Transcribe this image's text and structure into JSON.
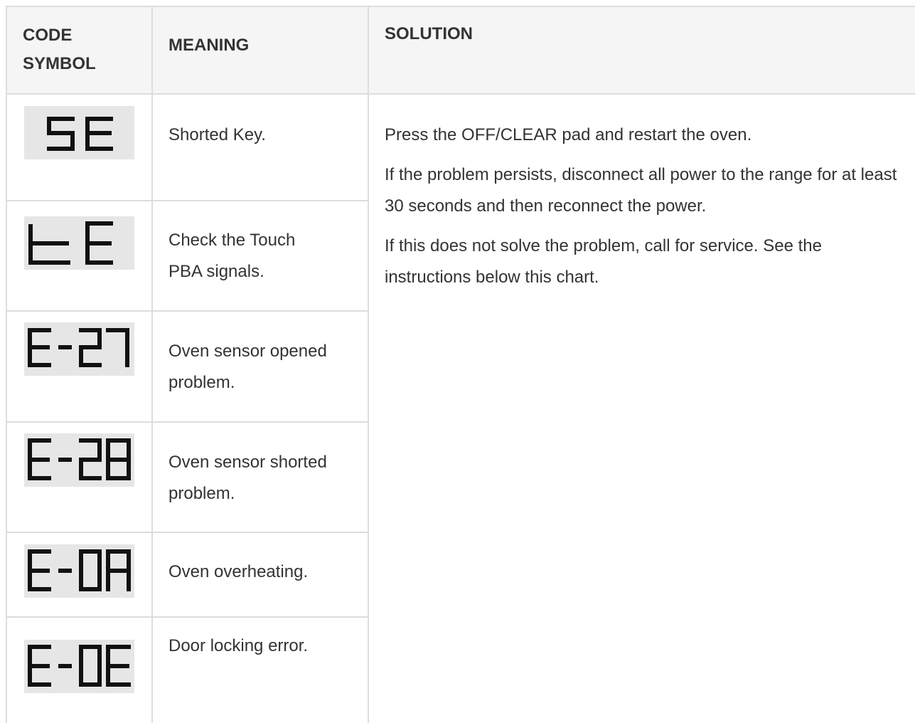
{
  "table": {
    "headers": {
      "code": [
        "CODE",
        "SYMBOL"
      ],
      "meaning": "MEANING",
      "solution": "SOLUTION"
    },
    "rows": [
      {
        "code": "SE",
        "meaning": "Shorted Key."
      },
      {
        "code": "tE",
        "meaning": "Check the Touch PBA signals."
      },
      {
        "code": "E-27",
        "meaning": "Oven sensor opened problem."
      },
      {
        "code": "E-28",
        "meaning": "Oven sensor shorted problem."
      },
      {
        "code": "E-0A",
        "meaning": "Oven overheating."
      },
      {
        "code": "E-0E",
        "meaning": "Door locking error."
      }
    ],
    "solution": [
      "Press the OFF/CLEAR pad and restart the oven.",
      "If the problem persists, disconnect all power to the range for at least 30 seconds and then reconnect the power.",
      "If this does not solve the problem, call for service. See the instructions below this chart."
    ]
  }
}
